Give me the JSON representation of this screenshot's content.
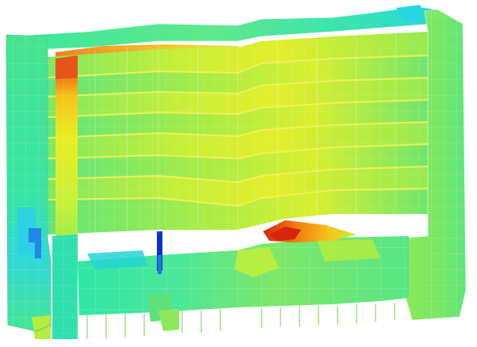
{
  "viewer": {
    "background": "#ffffff",
    "model": "building-structural-stress-contour",
    "palette": {
      "low": "#0a2fd6",
      "low_mid": "#1fd8e6",
      "mid": "#2ef58a",
      "mid_high": "#c8f03a",
      "high": "#f5e61a",
      "peak": "#f07a10",
      "max": "#d8240a"
    }
  }
}
